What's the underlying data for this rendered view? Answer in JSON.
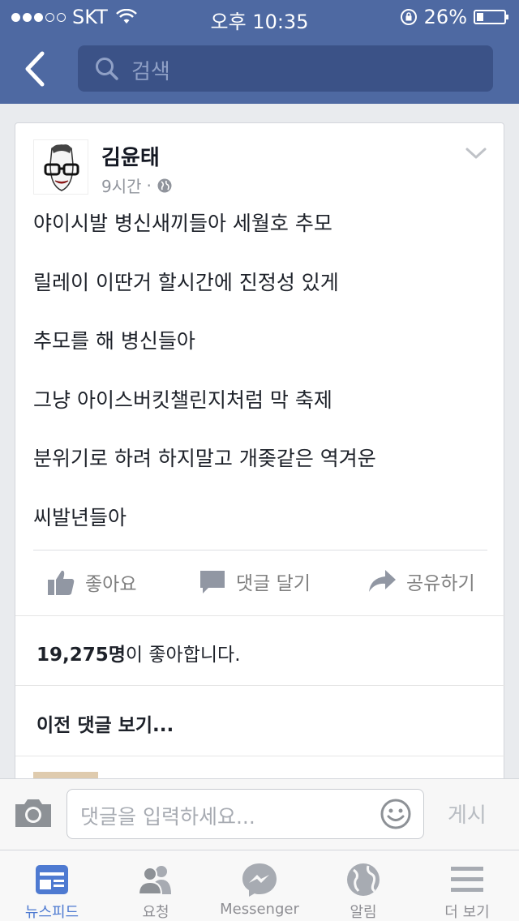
{
  "status_bar": {
    "carrier": "SKT",
    "time": "오후 10:35",
    "battery": "26%",
    "battery_level": 0.26
  },
  "header": {
    "search_placeholder": "검색"
  },
  "post": {
    "author": "김윤태",
    "time": "9시간",
    "separator": "·",
    "lines": [
      "야이시발 병신새끼들아 세월호 추모",
      "릴레이 이딴거 할시간에 진정성 있게",
      "추모를 해 병신들아",
      "그냥 아이스버킷챌린지처럼 막 축제",
      "분위기로 하려 하지말고 개좆같은 역겨운",
      "씨발년들아"
    ],
    "actions": {
      "like": "좋아요",
      "comment": "댓글 달기",
      "share": "공유하기"
    },
    "likes_count": "19,275명",
    "likes_suffix": "이 좋아합니다.",
    "previous_comments": "이전 댓글 보기..."
  },
  "comment_bar": {
    "placeholder": "댓글을 입력하세요...",
    "post_label": "게시"
  },
  "tabs": [
    {
      "label": "뉴스피드",
      "icon": "news-feed-icon",
      "active": true
    },
    {
      "label": "요청",
      "icon": "friend-requests-icon",
      "active": false
    },
    {
      "label": "Messenger",
      "icon": "messenger-icon",
      "active": false
    },
    {
      "label": "알림",
      "icon": "globe-notifications-icon",
      "active": false
    },
    {
      "label": "더 보기",
      "icon": "menu-icon",
      "active": false
    }
  ],
  "colors": {
    "brand": "#4e69a2",
    "search_bg": "#3b5287",
    "active_tab": "#4e7ad1",
    "muted": "#90949c"
  }
}
